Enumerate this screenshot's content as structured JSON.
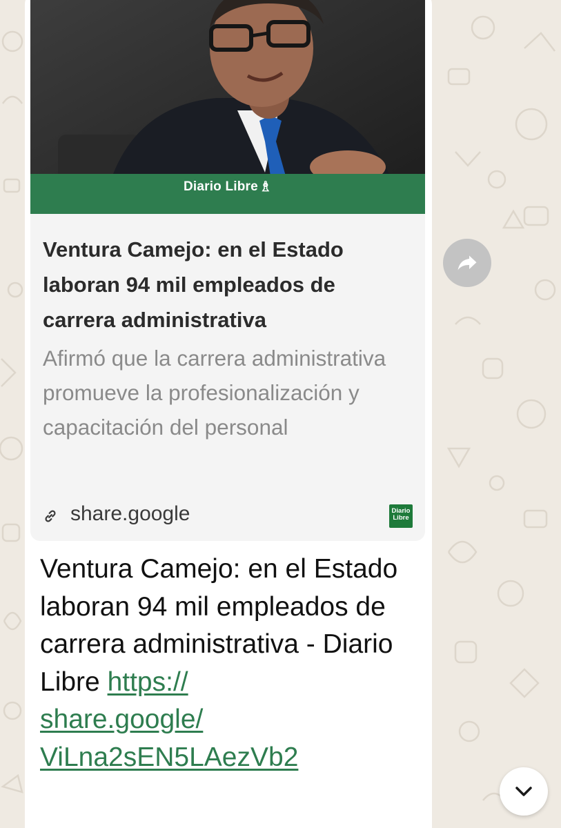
{
  "link_preview": {
    "image_alt": "Diario Libre article photo",
    "image_brand": "Diario Libre",
    "title": "Ventura Camejo: en el Estado laboran 94 mil empleados de carrera administrativa",
    "description": "Afirmó que la carrera administrativa promueve la profesionalización y capacitación del personal",
    "domain": "share.google",
    "favicon_text_line1": "Diario",
    "favicon_text_line2": "Libre",
    "link_icon": "link-icon"
  },
  "message": {
    "text": "Ventura Camejo: en el Estado laboran 94 mil empleados de carrera administrativa - Diario Libre ",
    "url_line1": "https://",
    "url_line2": "share.google/",
    "url_line3": "ViLna2sEN5LAezVb2"
  },
  "controls": {
    "forward_icon": "forward-arrow-icon",
    "scroll_icon": "chevron-down-icon"
  },
  "colors": {
    "chat_background": "#efeae2",
    "bubble": "#ffffff",
    "preview_card": "#f4f4f4",
    "brand_green": "#2e7d4f",
    "link_green": "#2e7d4f",
    "forward_button": "#c3c3c3"
  }
}
